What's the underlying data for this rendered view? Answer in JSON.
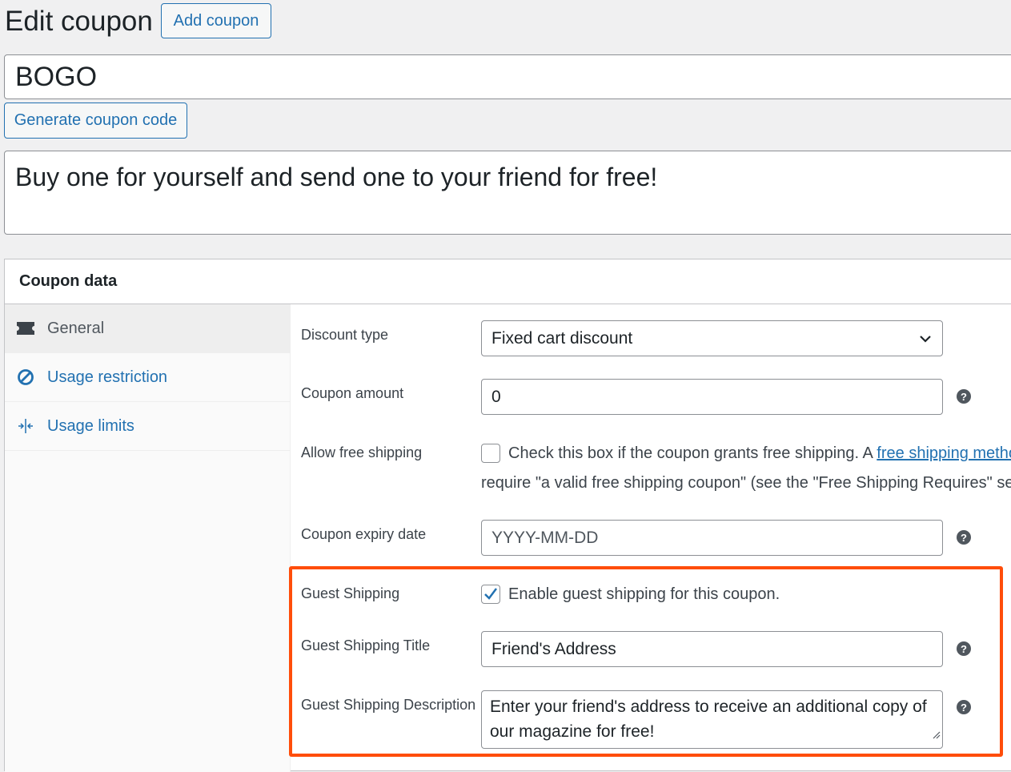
{
  "header": {
    "title": "Edit coupon",
    "add_button": "Add coupon"
  },
  "coupon": {
    "code": "BOGO",
    "generate_button": "Generate coupon code",
    "description": "Buy one for yourself and send one to your friend for free!"
  },
  "panel": {
    "title": "Coupon data",
    "tabs": [
      {
        "label": "General",
        "icon": "ticket-icon",
        "active": true
      },
      {
        "label": "Usage restriction",
        "icon": "ban-icon",
        "active": false
      },
      {
        "label": "Usage limits",
        "icon": "limits-icon",
        "active": false
      }
    ]
  },
  "general": {
    "discount_type": {
      "label": "Discount type",
      "value": "Fixed cart discount"
    },
    "coupon_amount": {
      "label": "Coupon amount",
      "value": "0"
    },
    "free_shipping": {
      "label": "Allow free shipping",
      "checked": false,
      "text_before": "Check this box if the coupon grants free shipping. A ",
      "link": "free shipping metho",
      "line2": "require \"a valid free shipping coupon\" (see the \"Free Shipping Requires\" setti"
    },
    "expiry_date": {
      "label": "Coupon expiry date",
      "placeholder": "YYYY-MM-DD"
    },
    "guest_shipping": {
      "label": "Guest Shipping",
      "checked": true,
      "text": "Enable guest shipping for this coupon."
    },
    "guest_shipping_title": {
      "label": "Guest Shipping Title",
      "value": "Friend's Address"
    },
    "guest_shipping_description": {
      "label": "Guest Shipping Description",
      "value": "Enter your friend's address to receive an additional copy of our magazine for free!"
    }
  },
  "colors": {
    "accent": "#2271b1",
    "highlight": "#ff4d0a",
    "background": "#f0f0f1"
  }
}
